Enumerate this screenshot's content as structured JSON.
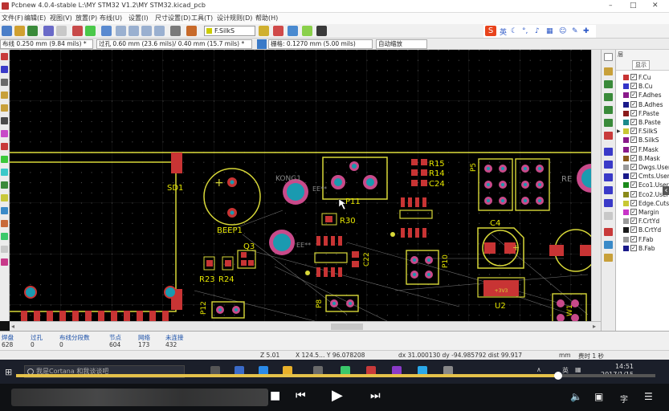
{
  "window": {
    "title": "Pcbnew 4.0.4-stable L:\\MY STM32 V1.2\\MY STM32.kicad_pcb",
    "controls": [
      "–",
      "□",
      "✕"
    ]
  },
  "menu": [
    "文件(F)",
    "编辑(E)",
    "视图(V)",
    "放置(P)",
    "布线(U)",
    "设置(I)",
    "尺寸设置(D)",
    "工具(T)",
    "设计规则(D)",
    "帮助(H)"
  ],
  "toolbar": {
    "active_layer": "F.SilkS",
    "ime_label": "英"
  },
  "toolbar2": {
    "track_width": "布线 0.250 mm (9.84 mils) *",
    "via_size": "过孔 0.60 mm (23.6 mils)/ 0.40 mm (15.7 mils) *",
    "grid": "栅格: 0.1270 mm (5.00 mils)",
    "zoom": "自动缩放"
  },
  "layers_panel": {
    "title": "层",
    "tab_label": "显示",
    "items": [
      {
        "name": "F.Cu",
        "color": "#c83434",
        "checked": true,
        "active": false
      },
      {
        "name": "B.Cu",
        "color": "#3434c8",
        "checked": true,
        "active": false
      },
      {
        "name": "F.Adhes",
        "color": "#8a1a8a",
        "checked": true,
        "active": false
      },
      {
        "name": "B.Adhes",
        "color": "#1a1a8a",
        "checked": true,
        "active": false
      },
      {
        "name": "F.Paste",
        "color": "#8a1a1a",
        "checked": true,
        "active": false
      },
      {
        "name": "B.Paste",
        "color": "#1a8a8a",
        "checked": true,
        "active": false
      },
      {
        "name": "F.SilkS",
        "color": "#c8c834",
        "checked": true,
        "active": true
      },
      {
        "name": "B.SilkS",
        "color": "#8a1a8a",
        "checked": true,
        "active": false
      },
      {
        "name": "F.Mask",
        "color": "#8a1a8a",
        "checked": true,
        "active": false
      },
      {
        "name": "B.Mask",
        "color": "#8a5a1a",
        "checked": true,
        "active": false
      },
      {
        "name": "Dwgs.User",
        "color": "#9a9a9a",
        "checked": true,
        "active": false
      },
      {
        "name": "Cmts.User",
        "color": "#1a1a8a",
        "checked": true,
        "active": false
      },
      {
        "name": "Eco1.User",
        "color": "#1a8a1a",
        "checked": true,
        "active": false
      },
      {
        "name": "Eco2.User",
        "color": "#8a8a1a",
        "checked": true,
        "active": false
      },
      {
        "name": "Edge.Cuts",
        "color": "#c8c834",
        "checked": true,
        "active": false
      },
      {
        "name": "Margin",
        "color": "#c834c8",
        "checked": true,
        "active": false
      },
      {
        "name": "F.CrtYd",
        "color": "#9a9a9a",
        "checked": true,
        "active": false
      },
      {
        "name": "B.CrtYd",
        "color": "#1a1a1a",
        "checked": true,
        "active": false
      },
      {
        "name": "F.Fab",
        "color": "#9a9a9a",
        "checked": true,
        "active": false
      },
      {
        "name": "B.Fab",
        "color": "#1a1a8a",
        "checked": true,
        "active": false
      }
    ]
  },
  "pcb": {
    "refs": [
      "SD1",
      "BEEP1",
      "KONG1",
      "P11",
      "R30",
      "R15",
      "R14",
      "C24",
      "U6",
      "P5",
      "C4",
      "U4",
      "C22",
      "P10",
      "Q3",
      "R23",
      "R24",
      "P12",
      "P8",
      "U2",
      "W1",
      "RE",
      "EE**",
      "EE**"
    ],
    "u2_value": "+3V3"
  },
  "status": [
    {
      "label": "焊盘",
      "value": "628"
    },
    {
      "label": "过孔",
      "value": "0"
    },
    {
      "label": "布线分段数",
      "value": "0"
    },
    {
      "label": "节点",
      "value": "604"
    },
    {
      "label": "网络",
      "value": "173"
    },
    {
      "label": "未连接",
      "value": "432"
    }
  ],
  "coords": {
    "zoom": "Z 5.01",
    "xy": "X 124.5… Y 96.078208",
    "delta": "dx 31.000130  dy -94.985792  dist 99.917",
    "units": "mm",
    "extra": "费时 1 秒"
  },
  "taskbar": {
    "search_placeholder": "我是Cortana 和我谈谈吧",
    "time": "14:51",
    "date": "2017/1/15",
    "lang": "英"
  },
  "player": {
    "progress": 0.848,
    "rate_label": "字"
  }
}
